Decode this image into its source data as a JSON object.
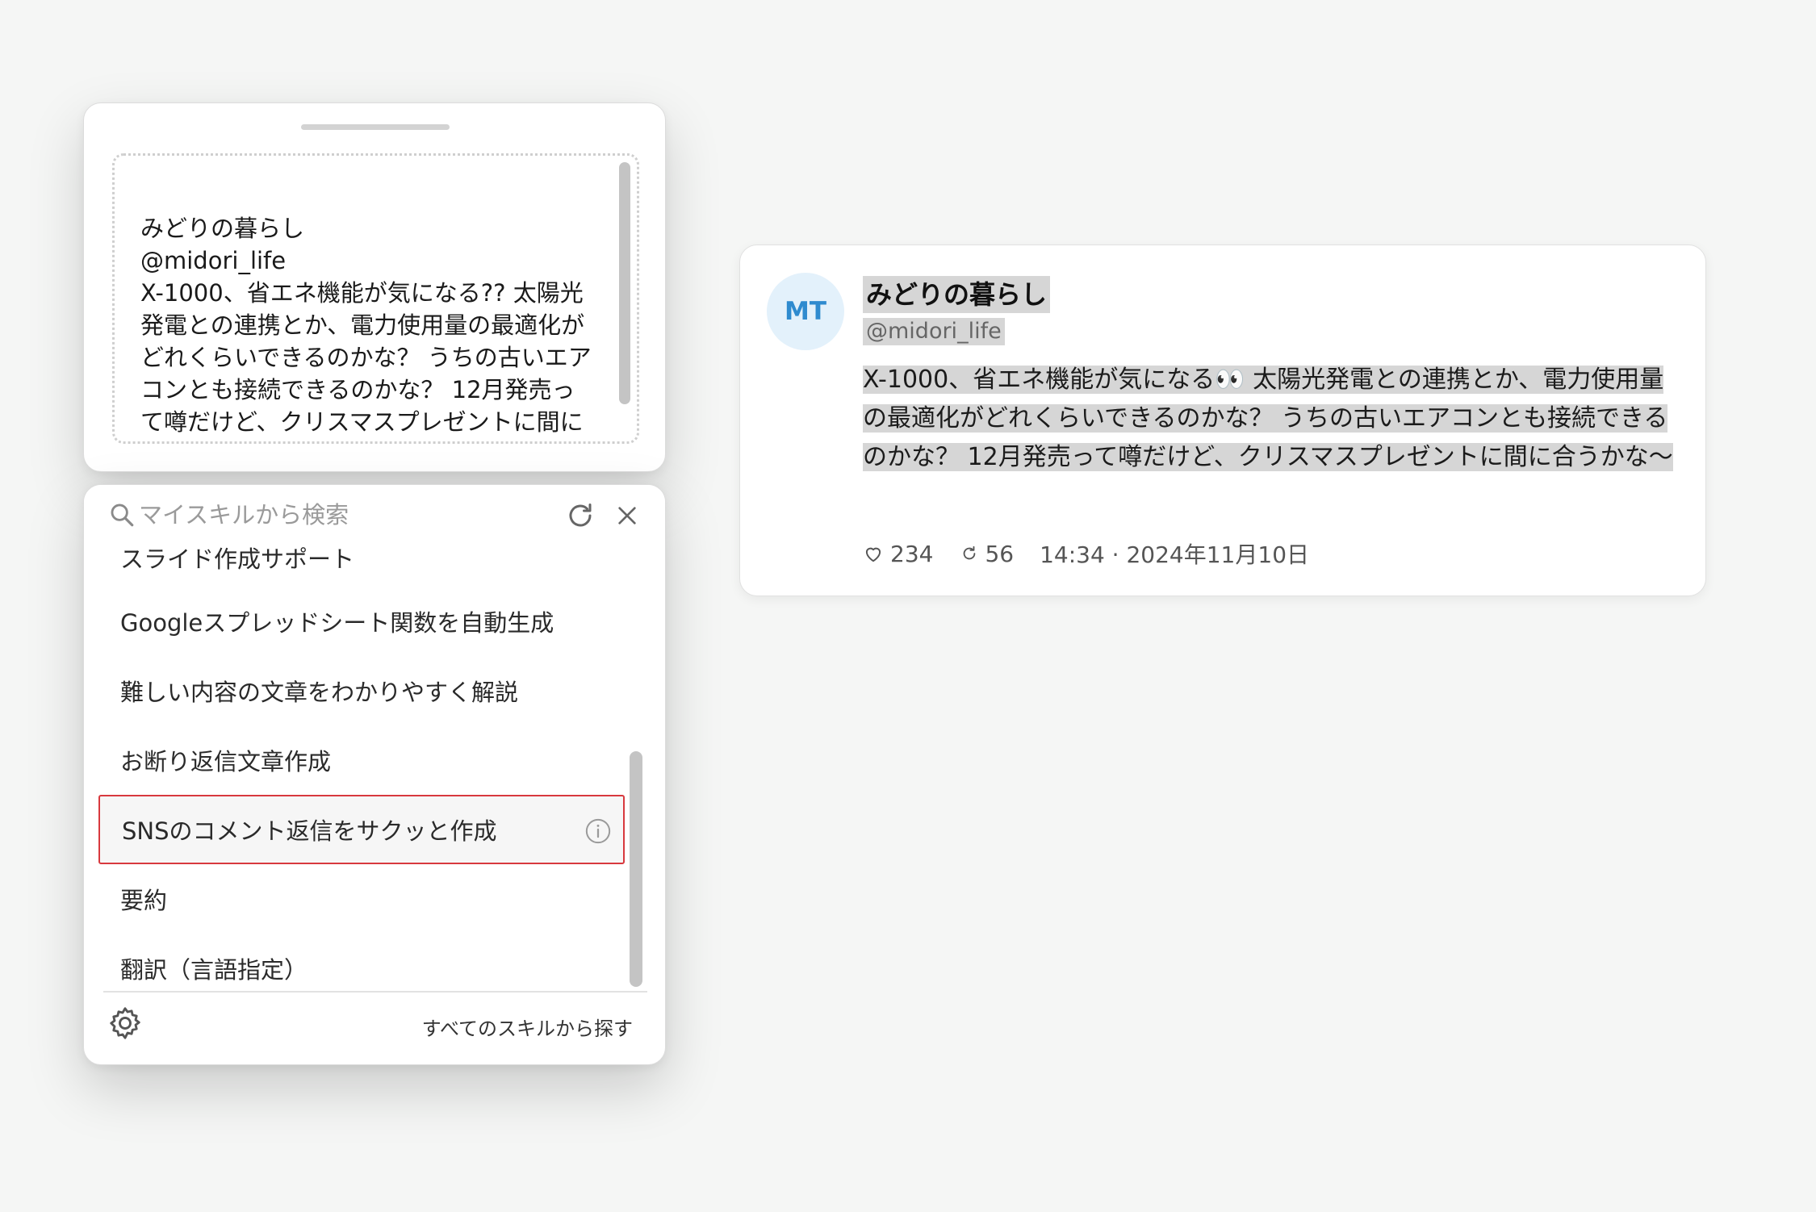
{
  "preview": {
    "text": "みどりの暮らし\n@midori_life\nX-1000、省エネ機能が気になる?? 太陽光発電との連携とか、電力使用量の最適化がどれくらいできるのかな？ うちの古いエアコンとも接続できるのかな？ 12月発売って噂だけど、クリスマスプレゼントに間に合うかな〜"
  },
  "skill_menu": {
    "search_placeholder": "マイスキルから検索",
    "items": [
      {
        "label": "スライド作成サポート"
      },
      {
        "label": "Googleスプレッドシート関数を自動生成"
      },
      {
        "label": "難しい内容の文章をわかりやすく解説"
      },
      {
        "label": "お断り返信文章作成"
      },
      {
        "label": "SNSのコメント返信をサクッと作成"
      },
      {
        "label": "要約"
      },
      {
        "label": "翻訳（言語指定）"
      }
    ],
    "selected_item": "SNSのコメント返信をサクッと作成",
    "footer_link": "すべてのスキルから探す",
    "accent_color": "#d8393e"
  },
  "tweet": {
    "avatar_initials": "MT",
    "display_name": "みどりの暮らし",
    "handle": "@midori_life",
    "body": "X-1000、省エネ機能が気になる👀 太陽光発電との連携とか、電力使用量の最適化がどれくらいできるのかな？ うちの古いエアコンとも接続できるのかな？ 12月発売って噂だけど、クリスマスプレゼントに間に合うかな〜",
    "likes": "234",
    "retweets": "56",
    "timestamp": "14:34 · 2024年11月10日",
    "avatar_color": "#2f8bcf"
  }
}
